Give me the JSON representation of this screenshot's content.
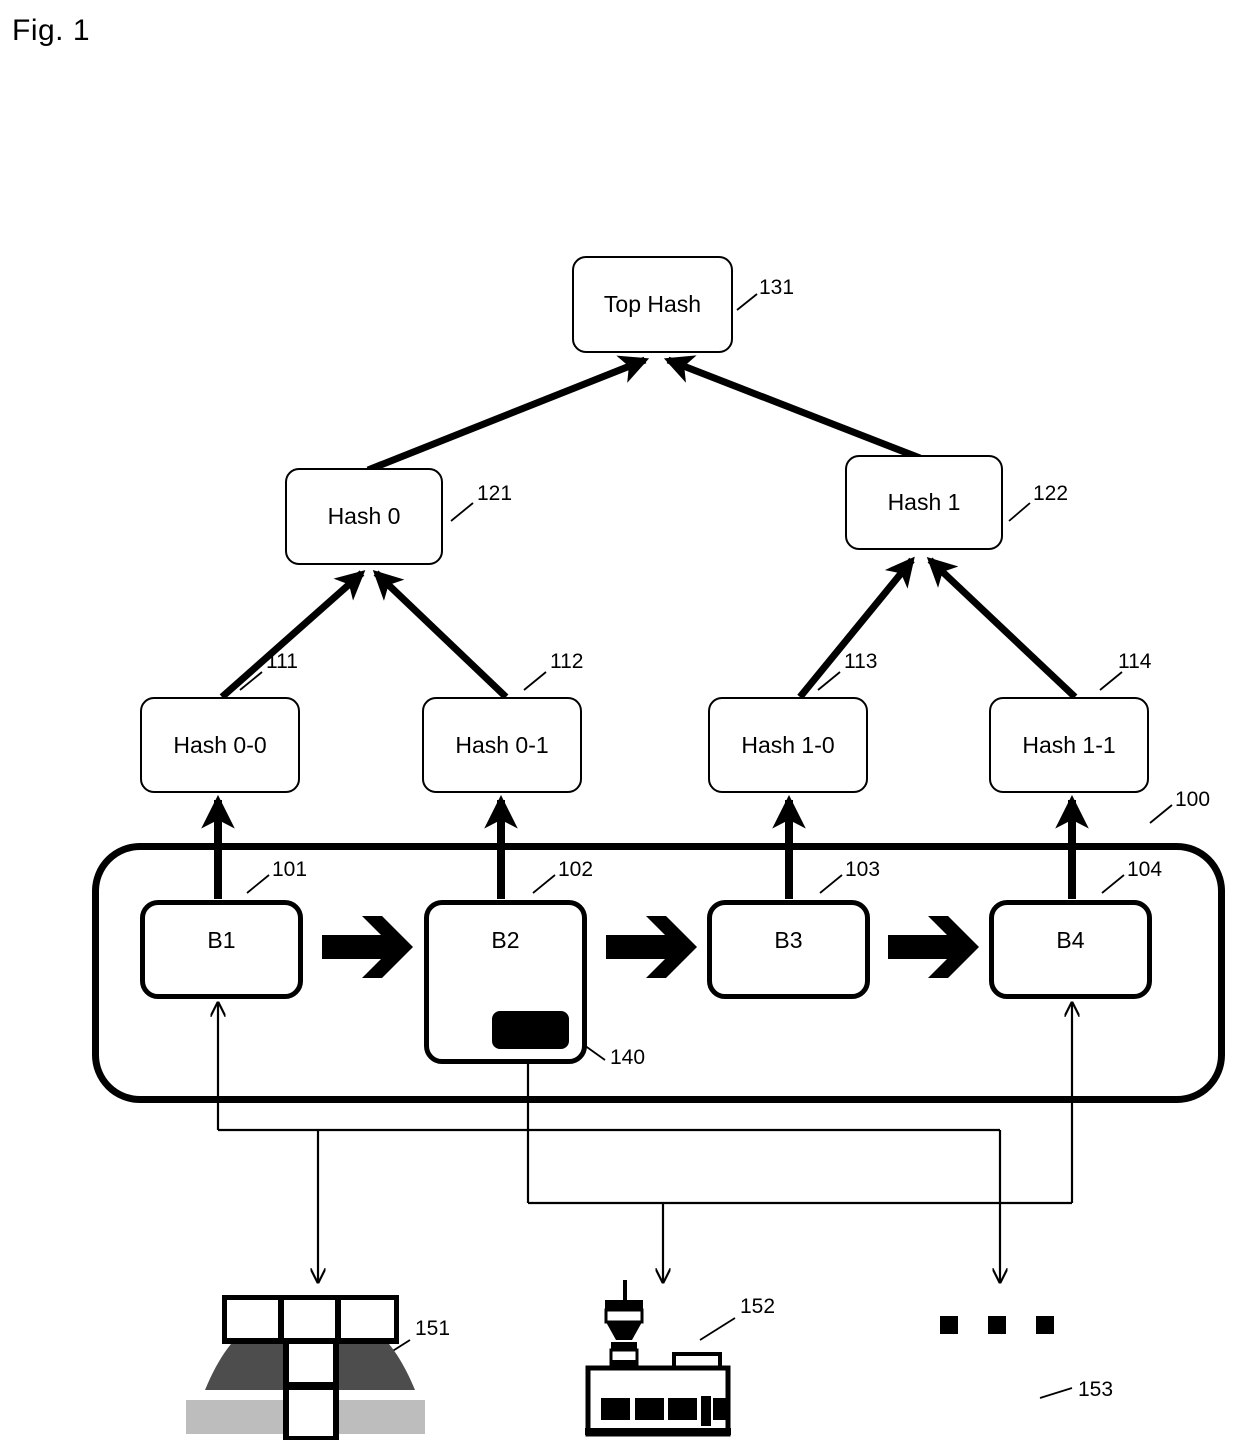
{
  "figure": {
    "title": "Fig. 1"
  },
  "merkle_tree": {
    "root": {
      "label": "Top Hash",
      "ref": "131"
    },
    "level1": [
      {
        "label": "Hash 0",
        "ref": "121"
      },
      {
        "label": "Hash 1",
        "ref": "122"
      }
    ],
    "leaves": [
      {
        "label": "Hash 0-0",
        "ref": "111"
      },
      {
        "label": "Hash 0-1",
        "ref": "112"
      },
      {
        "label": "Hash 1-0",
        "ref": "113"
      },
      {
        "label": "Hash 1-1",
        "ref": "114"
      }
    ]
  },
  "blockchain": {
    "ref": "100",
    "blocks": [
      {
        "label": "B1",
        "ref": "101"
      },
      {
        "label": "B2",
        "ref": "102"
      },
      {
        "label": "B3",
        "ref": "103"
      },
      {
        "label": "B4",
        "ref": "104"
      }
    ],
    "payload": {
      "ref": "140"
    }
  },
  "devices": [
    {
      "icon": "solar-panel-icon",
      "ref": "151"
    },
    {
      "icon": "factory-plant-icon",
      "ref": "152"
    },
    {
      "icon": "ellipsis-dots-icon",
      "ref": "153"
    }
  ]
}
